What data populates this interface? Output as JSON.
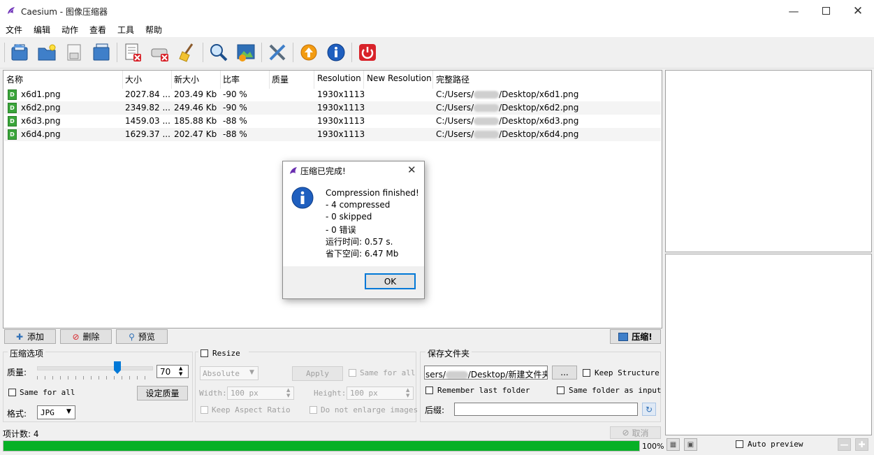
{
  "window": {
    "title": "Caesium - 图像压缩器"
  },
  "menu": [
    "文件",
    "编辑",
    "动作",
    "查看",
    "工具",
    "帮助"
  ],
  "columns": [
    "名称",
    "大小",
    "新大小",
    "比率",
    "质量",
    "Resolution",
    "New Resolution",
    "完整路径"
  ],
  "files": [
    {
      "name": "x6d1.png",
      "size": "2027.84 ...",
      "new_size": "203.49 Kb",
      "ratio": "-90 %",
      "quality": "",
      "resolution": "1930x1113",
      "new_resolution": "",
      "path_pre": "C:/Users/",
      "path_post": "/Desktop/x6d1.png"
    },
    {
      "name": "x6d2.png",
      "size": "2349.82 ...",
      "new_size": "249.46 Kb",
      "ratio": "-90 %",
      "quality": "",
      "resolution": "1930x1113",
      "new_resolution": "",
      "path_pre": "C:/Users/",
      "path_post": "/Desktop/x6d2.png"
    },
    {
      "name": "x6d3.png",
      "size": "1459.03 ...",
      "new_size": "185.88 Kb",
      "ratio": "-88 %",
      "quality": "",
      "resolution": "1930x1113",
      "new_resolution": "",
      "path_pre": "C:/Users/",
      "path_post": "/Desktop/x6d3.png"
    },
    {
      "name": "x6d4.png",
      "size": "1629.37 ...",
      "new_size": "202.47 Kb",
      "ratio": "-88 %",
      "quality": "",
      "resolution": "1930x1113",
      "new_resolution": "",
      "path_pre": "C:/Users/",
      "path_post": "/Desktop/x6d4.png"
    }
  ],
  "list_actions": {
    "add": "添加",
    "remove": "删除",
    "preview": "预览",
    "compress": "压缩!"
  },
  "compression": {
    "title": "压缩选项",
    "quality_label": "质量:",
    "quality_value": "70",
    "quality_fraction": 0.7,
    "same_for_all": "Same for all",
    "set_quality": "设定质量",
    "format_label": "格式:",
    "format_value": "JPG"
  },
  "resize": {
    "title": "Resize",
    "mode": "Absolute",
    "apply": "Apply",
    "same_for_all": "Same for all",
    "width_label": "Width:",
    "width_value": "100 px",
    "height_label": "Height:",
    "height_value": "100 px",
    "keep_aspect": "Keep Aspect Ratio",
    "no_enlarge": "Do not enlarge images"
  },
  "output": {
    "title": "保存文件夹",
    "folder_pre": "sers/",
    "folder_post": "/Desktop/新建文件夹",
    "browse": "...",
    "keep_structure": "Keep Structure",
    "remember_last": "Remember last folder",
    "same_as_input": "Same folder as input",
    "suffix_label": "后缀:",
    "suffix_value": ""
  },
  "status": {
    "item_count": "项计数: 4",
    "cancel": "取消",
    "progress_text": "100%",
    "progress_fraction": 1.0
  },
  "preview": {
    "auto_preview": "Auto preview"
  },
  "dialog": {
    "title": "压缩已完成!",
    "lines": [
      "Compression finished!",
      "- 4 compressed",
      "- 0 skipped",
      "- 0 错误",
      "运行时间: 0.57 s.",
      "省下空间: 6.47 Mb"
    ],
    "ok": "OK"
  },
  "colors": {
    "progress": "#06b025",
    "selection": "#0078d7"
  }
}
